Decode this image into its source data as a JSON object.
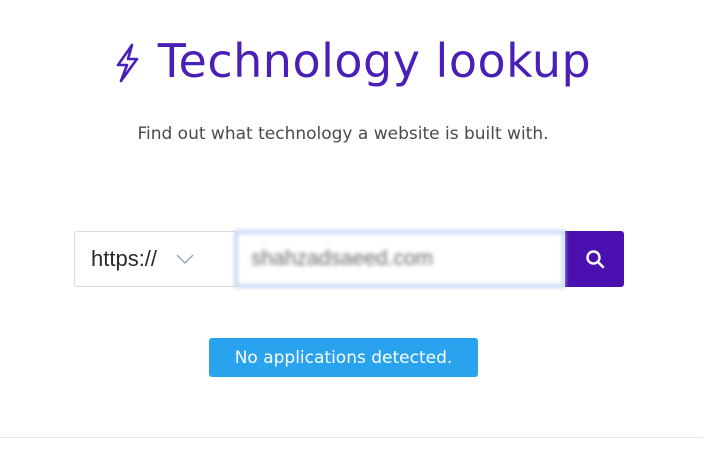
{
  "header": {
    "title": "Technology lookup",
    "logo_icon": "lightning-bolt-icon",
    "title_color": "#4a1fb8"
  },
  "subtitle": "Find out what technology a website is built with.",
  "search": {
    "protocol": {
      "selected": "https://",
      "icon": "chevron-down-icon"
    },
    "url_value": "shahzadsaeed.com",
    "button_icon": "search-icon",
    "button_color": "#4b11b0"
  },
  "status": {
    "message": "No applications detected.",
    "color": "#2aa3ee"
  }
}
